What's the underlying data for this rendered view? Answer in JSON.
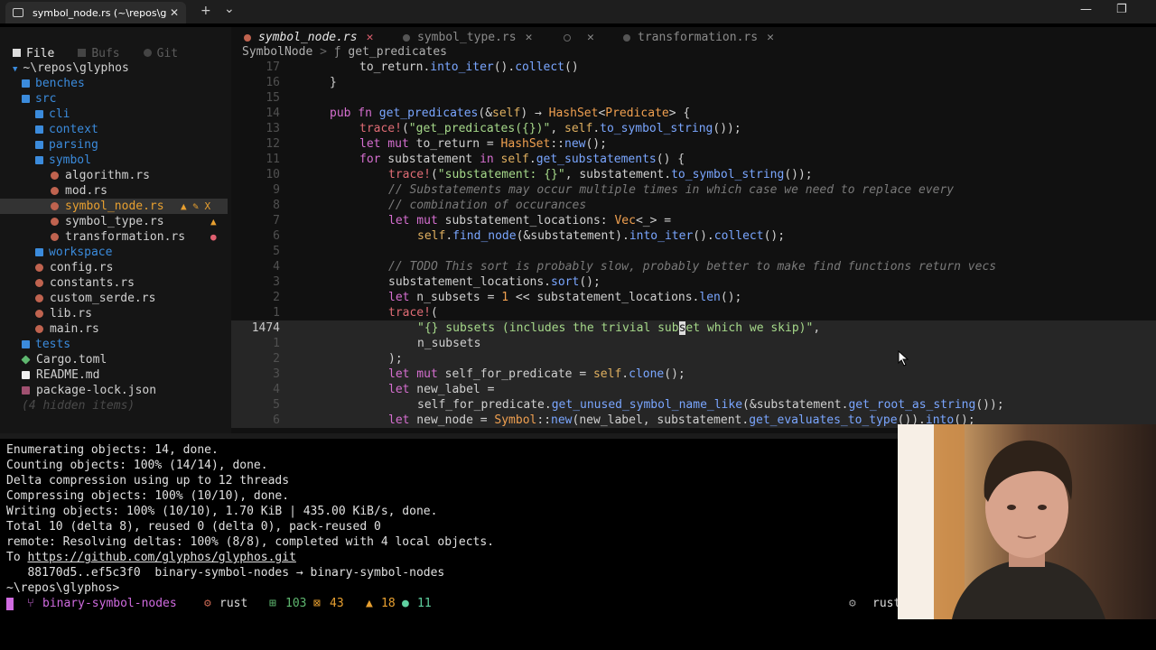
{
  "window": {
    "tab_title": "symbol_node.rs (~\\repos\\glyp",
    "tab_close": "✕",
    "new_tab": "+",
    "dropdown": "⌄",
    "minimize": "—",
    "maximize": "❐",
    "close": "✕"
  },
  "sidebar": {
    "tabs": [
      "File",
      "Bufs",
      "Git"
    ],
    "root": "~\\repos\\glyphos",
    "items": [
      {
        "label": "benches",
        "type": "folder"
      },
      {
        "label": "src",
        "type": "folder"
      },
      {
        "label": "cli",
        "type": "folder"
      },
      {
        "label": "context",
        "type": "folder"
      },
      {
        "label": "parsing",
        "type": "folder"
      },
      {
        "label": "symbol",
        "type": "folder"
      },
      {
        "label": "algorithm.rs",
        "type": "file"
      },
      {
        "label": "mod.rs",
        "type": "file"
      },
      {
        "label": "symbol_node.rs",
        "type": "file",
        "status": "▲ ✎ X"
      },
      {
        "label": "symbol_type.rs",
        "type": "file",
        "status": "▲"
      },
      {
        "label": "transformation.rs",
        "type": "file",
        "status": "●"
      },
      {
        "label": "workspace",
        "type": "folder"
      },
      {
        "label": "config.rs",
        "type": "file"
      },
      {
        "label": "constants.rs",
        "type": "file"
      },
      {
        "label": "custom_serde.rs",
        "type": "file"
      },
      {
        "label": "lib.rs",
        "type": "file"
      },
      {
        "label": "main.rs",
        "type": "file"
      },
      {
        "label": "tests",
        "type": "folder"
      },
      {
        "label": "Cargo.toml",
        "type": "file"
      },
      {
        "label": "README.md",
        "type": "file"
      },
      {
        "label": "package-lock.json",
        "type": "file"
      }
    ],
    "hidden": "(4 hidden items)"
  },
  "editor": {
    "tabs": [
      {
        "label": "symbol_node.rs",
        "close": "✕"
      },
      {
        "label": "symbol_type.rs",
        "close": "✕"
      },
      {
        "label": "",
        "close": "✕"
      },
      {
        "label": "transformation.rs",
        "close": "✕"
      }
    ],
    "breadcrumb": {
      "item1": "SymbolNode",
      "sep": ">",
      "fn_icon": "ƒ",
      "item2": "get_predicates"
    },
    "line_numbers": [
      "17",
      "16",
      "15",
      "14",
      "13",
      "12",
      "11",
      "10",
      "9",
      "8",
      "7",
      "6",
      "5",
      "4",
      "3",
      "2",
      "1",
      "1474",
      "1",
      "2",
      "3",
      "4",
      "5",
      "6"
    ],
    "cursor_line": "1474"
  },
  "terminal": {
    "lines": [
      "Enumerating objects: 14, done.",
      "Counting objects: 100% (14/14), done.",
      "Delta compression using up to 12 threads",
      "Compressing objects: 100% (10/10), done.",
      "Writing objects: 100% (10/10), 1.70 KiB | 435.00 KiB/s, done.",
      "Total 10 (delta 8), reused 0 (delta 0), pack-reused 0",
      "remote: Resolving deltas: 100% (8/8), completed with 4 local objects."
    ],
    "to_label": "To ",
    "remote_url": "https://github.com/glyphos/glyphos.git",
    "push_line": "   88170d5..ef5c3f0  binary-symbol-nodes → binary-symbol-nodes",
    "prompt": "~\\repos\\glyphos>"
  },
  "statusbar": {
    "branch": "binary-symbol-nodes",
    "lang": "rust",
    "added": "103",
    "modified": "43",
    "warnings": "18",
    "hints": "11",
    "right": "rust"
  },
  "colors": {
    "folder": "#3b8bdc",
    "rust_file": "#c0634f",
    "accent": "#d06be0"
  }
}
